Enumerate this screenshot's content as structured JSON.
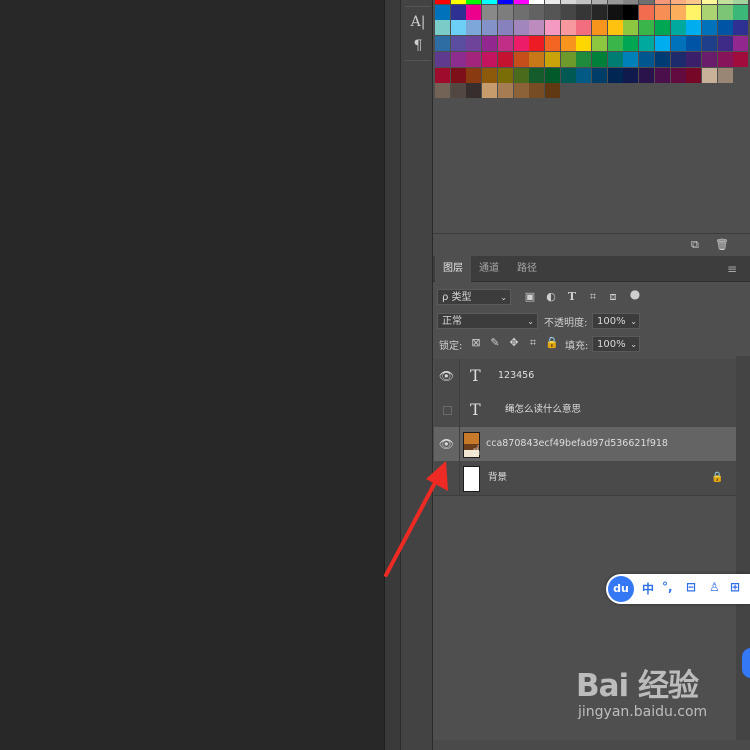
{
  "colors": {
    "accent_blue": "#3478f6",
    "arrow_red": "#ee2a24",
    "panel_bg": "#4f4f4f",
    "canvas_bg": "#282828"
  },
  "tools": {
    "text_tool": "A|",
    "paragraph_tool": "¶"
  },
  "layers_panel": {
    "tabs": [
      {
        "label": "图层"
      },
      {
        "label": "通道"
      },
      {
        "label": "路径"
      }
    ],
    "menu_icon": "≡",
    "filter": {
      "value": "ρ 类型"
    },
    "filter_icons": [
      "image-filter-icon",
      "adjustment-filter-icon",
      "type-filter-icon",
      "shape-filter-icon",
      "smart-object-filter-icon",
      "filter-toggle-icon"
    ],
    "blend_mode": {
      "value": "正常"
    },
    "opacity": {
      "label": "不透明度:",
      "value": "100%"
    },
    "lock": {
      "label": "锁定:"
    },
    "fill": {
      "label": "填充:",
      "value": "100%"
    },
    "layers": [
      {
        "name": "123456",
        "type": "text",
        "visible": true
      },
      {
        "name": "绳怎么读什么意思",
        "type": "text",
        "visible": false
      },
      {
        "name": "cca870843ecf49befad97d536621f918",
        "type": "image",
        "visible": true,
        "selected": true
      },
      {
        "name": "背景",
        "type": "background",
        "visible": true,
        "locked": true
      }
    ]
  },
  "swatches_footer": {
    "new_swatch_icon": "new-swatch-icon",
    "delete_icon": "trash-icon"
  },
  "baidu_toolbar": {
    "logo": "du",
    "lang": "中",
    "punct": "°,",
    "items": [
      "toolbox-icon",
      "user-icon",
      "grid-icon"
    ]
  },
  "watermark": {
    "logo_text": "Bai 经验",
    "url": "jingyan.baidu.com"
  }
}
